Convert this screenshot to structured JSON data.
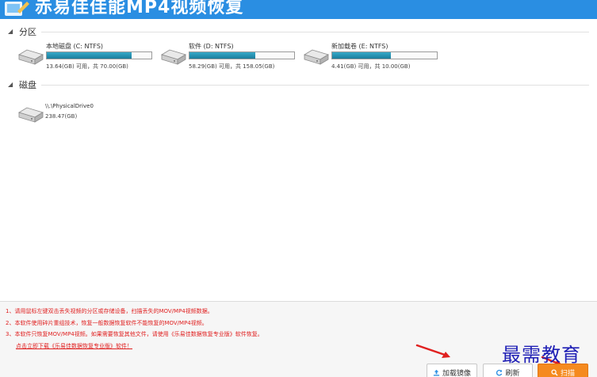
{
  "window": {
    "title": "赤易佳佳能MP4视频恢复"
  },
  "partitions": {
    "header": "分区",
    "drives": [
      {
        "name": "本地磁盘 (C: NTFS)",
        "space": "13.64(GB) 可用，共 70.00(GB)",
        "used_fraction": 0.81
      },
      {
        "name": "软件 (D: NTFS)",
        "space": "58.29(GB) 可用，共 158.05(GB)",
        "used_fraction": 0.63
      },
      {
        "name": "新加载卷 (E: NTFS)",
        "space": "4.41(GB) 可用，共 10.00(GB)",
        "used_fraction": 0.56
      }
    ]
  },
  "disks": {
    "header": "磁盘",
    "items": [
      {
        "name": "\\\\.\\PhysicalDrive0",
        "size": "238.47(GB)"
      }
    ]
  },
  "notes": [
    "1、请用鼠标左键双击丢失视频的分区或存储设备，扫描丢失的MOV/MP4视频数据。",
    "2、本软件使用碎片重组技术，恢复一般数据恢复软件不能恢复的MOV/MP4视频。",
    "3、本软件只恢复MOV/MP4视频。如果需要恢复其他文件，请使用《乐易佳数据恢复专业版》软件恢复。"
  ],
  "download_link": "点击立即下载《乐易佳数据恢复专业版》软件！",
  "buttons": {
    "load_image": "加载镜像",
    "refresh": "刷新",
    "scan": "扫描"
  },
  "watermark": "最需教育",
  "colors": {
    "titlebar": "#2a8ee2",
    "progress": "#2590b0",
    "scan_button": "#f58a1f",
    "note_text": "#e02020"
  }
}
